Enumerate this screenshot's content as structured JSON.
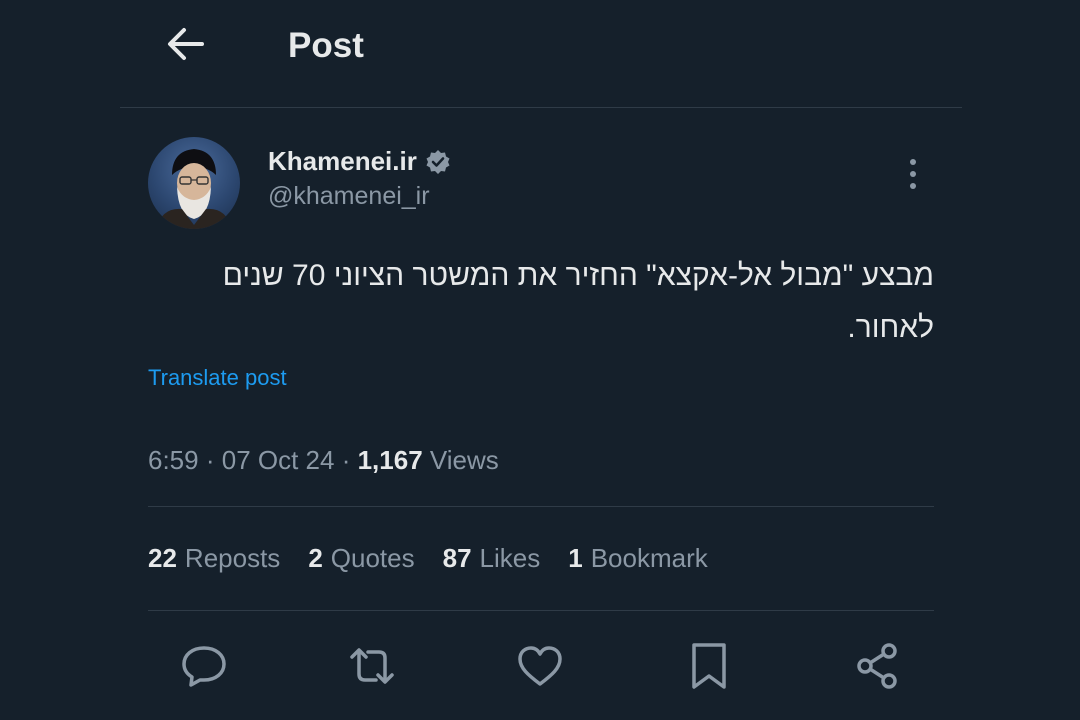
{
  "header": {
    "back_icon": "arrow-left-icon",
    "title": "Post"
  },
  "author": {
    "display_name": "Khamenei.ir",
    "handle": "@khamenei_ir",
    "verified_icon": "verified-badge-icon",
    "verified_color": "#8b98a5"
  },
  "post": {
    "text": "מבצע \"מבול אל-אקצא\" החזיר את המשטר הציוני 70 שנים לאחור.",
    "translate_label": "Translate post"
  },
  "meta": {
    "time": "6:59",
    "date": "07 Oct 24",
    "views_count": "1,167",
    "views_label": "Views"
  },
  "stats": [
    {
      "count": "22",
      "label": "Reposts"
    },
    {
      "count": "2",
      "label": "Quotes"
    },
    {
      "count": "87",
      "label": "Likes"
    },
    {
      "count": "1",
      "label": "Bookmark"
    }
  ],
  "actions": [
    "reply-icon",
    "repost-icon",
    "like-icon",
    "bookmark-icon",
    "share-icon"
  ],
  "colors": {
    "background": "#15202b",
    "text": "#e7e9ea",
    "secondary": "#8b98a5",
    "accent": "#1d9bf0",
    "divider": "#2f3b47"
  }
}
